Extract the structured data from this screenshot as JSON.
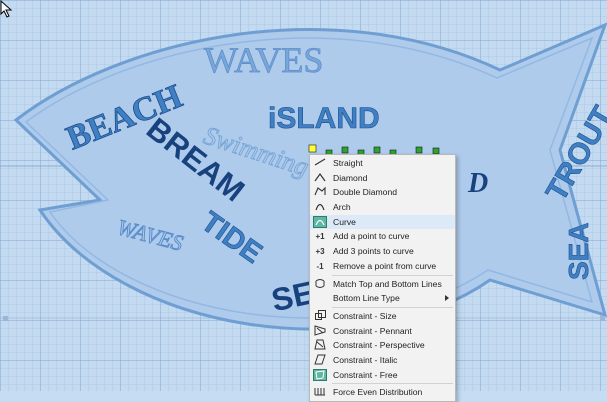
{
  "canvas": {
    "text_items": [
      "BEACH",
      "WAVES",
      "iSLAND",
      "BREAM",
      "TIDE",
      "WAVES",
      "Swimming",
      "TROUT",
      "SEA",
      "SE",
      "D"
    ]
  },
  "context_menu": {
    "items": [
      {
        "label": "Straight",
        "icon": "straight-icon"
      },
      {
        "label": "Diamond",
        "icon": "diamond-icon"
      },
      {
        "label": "Double Diamond",
        "icon": "double-diamond-icon"
      },
      {
        "label": "Arch",
        "icon": "arch-icon"
      },
      {
        "label": "Curve",
        "icon": "curve-icon",
        "highlighted": true
      },
      {
        "label": "Add a point to curve",
        "icon_text": "+1"
      },
      {
        "label": "Add 3 points to curve",
        "icon_text": "+3"
      },
      {
        "label": "Remove a point from curve",
        "icon_text": "-1"
      },
      {
        "label": "Match Top and Bottom Lines",
        "icon": "match-lines-icon"
      },
      {
        "label": "Bottom Line Type",
        "has_submenu": true
      },
      {
        "label": "Constraint - Size",
        "icon": "constraint-size-icon"
      },
      {
        "label": "Constraint - Pennant",
        "icon": "constraint-pennant-icon"
      },
      {
        "label": "Constraint - Perspective",
        "icon": "constraint-perspective-icon"
      },
      {
        "label": "Constraint - Italic",
        "icon": "constraint-italic-icon"
      },
      {
        "label": "Constraint - Free",
        "icon": "constraint-free-icon"
      },
      {
        "label": "Force Even Distribution",
        "icon": "even-distribution-icon"
      }
    ]
  },
  "colors": {
    "canvas_bg": "#c3daf1",
    "fish_fill": "#aecbec",
    "fish_outline": "#6f9fd2",
    "text_mid_blue": "#3f7fc4",
    "text_dark_blue": "#18427e",
    "text_light_blue": "#7ba7d8",
    "menu_bg": "#f2f2f2",
    "menu_highlight": "#dce9f7"
  }
}
